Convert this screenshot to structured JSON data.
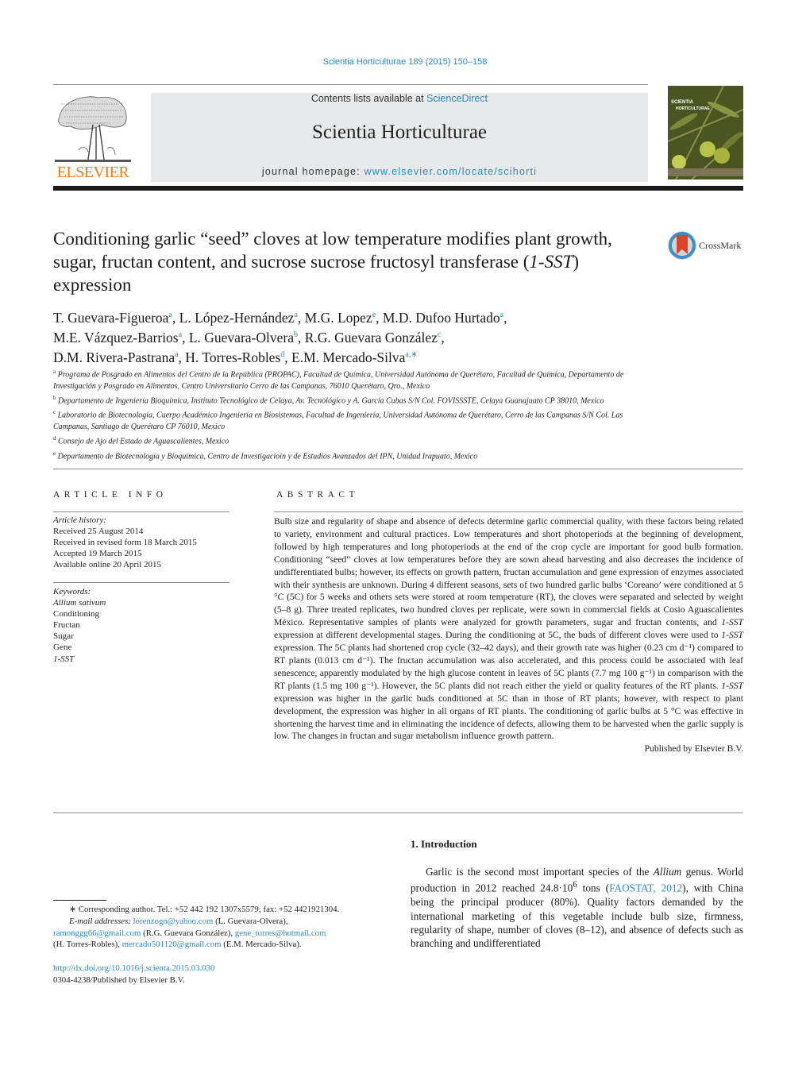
{
  "header": {
    "journal_ref": "Scientia Horticulturae 189 (2015) 150–158",
    "contents_prefix": "Contents lists available at ",
    "contents_link": "ScienceDirect",
    "journal_title": "Scientia Horticulturae",
    "homepage_prefix": "journal homepage: ",
    "homepage_link": "www.elsevier.com/locate/scihorti",
    "publisher_logo_text": "ELSEVIER",
    "cover_title_line1": "SCIENTIA",
    "cover_title_line2": "HORTICULTURAE"
  },
  "article": {
    "title_part1": "Conditioning garlic “seed” cloves at low temperature modifies plant growth, sugar, fructan content, and sucrose sucrose fructosyl transferase (",
    "title_italic": "1-SST",
    "title_part2": ") expression",
    "crossmark_label": "CrossMark",
    "authors": [
      {
        "name": "T. Guevara-Figueroa",
        "sup": "a",
        "sep": ", "
      },
      {
        "name": "L. López-Hernández",
        "sup": "a",
        "sep": ", "
      },
      {
        "name": "M.G. Lopez",
        "sup": "e",
        "sep": ", "
      },
      {
        "name": "M.D. Dufoo Hurtado",
        "sup": "a",
        "sep": ","
      },
      {
        "name": "M.E. Vázquez-Barrios",
        "sup": "a",
        "sep": ", "
      },
      {
        "name": "L. Guevara-Olvera",
        "sup": "b",
        "sep": ", "
      },
      {
        "name": "R.G. Guevara González",
        "sup": "c",
        "sep": ","
      },
      {
        "name": "D.M. Rivera-Pastrana",
        "sup": "a",
        "sep": ", "
      },
      {
        "name": "H. Torres-Robles",
        "sup": "d",
        "sep": ", "
      },
      {
        "name": "E.M. Mercado-Silva",
        "sup": "a,∗",
        "sep": ""
      }
    ],
    "affiliations": [
      {
        "key": "a",
        "text": "Programa de Posgrado en Alimentos del Centro de la República (PROPAC), Facultad de Química, Universidad Autónoma de Querétaro, Facultad de Química, Departamento de Investigación y Posgrado en Alimentos, Centro Universitario Cerro de las Campanas, 76010 Querétaro, Qro., Mexico"
      },
      {
        "key": "b",
        "text": "Departamento de Ingeniería Bioquímica, Instituto Tecnológico de Celaya, Av. Tecnológico y A. García Cubas S/N Col. FOVISSSTE, Celaya Guanajuato CP 38010, Mexico"
      },
      {
        "key": "c",
        "text": "Laboratorio de Biotecnología, Cuerpo Académico Ingeniería en Biosistemas, Facultad de Ingeniería, Universidad Autónoma de Querétaro, Cerro de las Campanas S/N Col. Las Campanas, Santiago de Querétaro CP 76010, Mexico"
      },
      {
        "key": "d",
        "text": "Consejo de Ajo del Estado de Aguascalientes, Mexico"
      },
      {
        "key": "e",
        "text": "Departamento de Biotecnología y Bioquímica, Centro de Investigacioín y de Estudios Avanzados del IPN, Unidad Irapuato, Mexico"
      }
    ]
  },
  "article_info": {
    "heading": "ARTICLE INFO",
    "history_label": "Article history:",
    "history": [
      "Received 25 August 2014",
      "Received in revised form 18 March 2015",
      "Accepted 19 March 2015",
      "Available online 20 April 2015"
    ],
    "keywords_label": "Keywords:",
    "keywords": [
      {
        "text": "Allium sativum",
        "italic": true
      },
      {
        "text": "Conditioning",
        "italic": false
      },
      {
        "text": "Fructan",
        "italic": false
      },
      {
        "text": "Sugar",
        "italic": false
      },
      {
        "text": "Gene",
        "italic": false
      },
      {
        "text": "1-SST",
        "italic": true
      }
    ]
  },
  "abstract": {
    "heading": "ABSTRACT",
    "segments": [
      {
        "t": "Bulb size and regularity of shape and absence of defects determine garlic commercial quality, with these factors being related to variety, environment and cultural practices. Low temperatures and short photoperiods at the beginning of development, followed by high temperatures and long photoperiods at the end of the crop cycle are important for good bulb formation. Conditioning “seed” cloves at low temperatures before they are sown ahead harvesting and also decreases the incidence of undifferentiated bulbs; however, its effects on growth pattern, fructan accumulation and gene expression of enzymes associated with their synthesis are unknown. During 4 different seasons, sets of two hundred garlic bulbs ‘Coreano’ were conditioned at 5 °C (5C) for 5 weeks and others sets were stored at room temperature (RT), the cloves were separated and selected by weight (5–8 g). Three treated replicates, two hundred cloves per replicate, were sown in commercial fields at Cosio Aguascalientes México. Representative samples of plants were analyzed for growth parameters, sugar and fructan contents, and ",
        "i": false
      },
      {
        "t": "1-SST",
        "i": true
      },
      {
        "t": " expression at different developmental stages. During the conditioning at 5C, the buds of different cloves were used to ",
        "i": false
      },
      {
        "t": "1-SST",
        "i": true
      },
      {
        "t": " expression. The 5C plants had shortened crop cycle (32–42 days), and their growth rate was higher (0.23 cm d⁻¹) compared to RT plants (0.013 cm d⁻¹). The fructan accumulation was also accelerated, and this process could be associated with leaf senescence, apparently modulated by the high glucose content in leaves of 5C plants (7.7 mg 100 g⁻¹) in comparison with the RT plants (1.5 mg 100 g⁻¹). However, the 5C plants did not reach either the yield or quality features of the RT plants. ",
        "i": false
      },
      {
        "t": "1-SST",
        "i": true
      },
      {
        "t": " expression was higher in the garlic buds conditioned at 5C than in those of RT plants; however, with respect to plant development, the expression was higher in all organs of RT plants. The conditioning of garlic bulbs at 5 °C was effective in shortening the harvest time and in eliminating the incidence of defects, allowing them to be harvested when the garlic supply is low. The changes in fructan and sugar metabolism influence growth pattern.",
        "i": false
      }
    ],
    "publisher_line": "Published by Elsevier B.V."
  },
  "introduction": {
    "heading": "1.  Introduction",
    "p1_a": "Garlic is the second most important species of the ",
    "p1_italic": "Allium",
    "p1_b": " genus. World production in 2012 reached 24.8·10",
    "p1_sup": "6",
    "p1_c": " tons (",
    "p1_link": "FAOSTAT, 2012",
    "p1_d": "), with China being the principal producer (80%). Quality factors demanded by the international marketing of this vegetable include bulb size, firmness, regularity of shape, number of cloves (8–12), and absence of defects such as branching and undifferentiated"
  },
  "footnotes": {
    "corresponding": "∗  Corresponding author. Tel.: +52 442 192 1307x5579; fax: +52 4421921304.",
    "email_label": "E-mail addresses: ",
    "emails": [
      {
        "email": "lorenzogo@yahoo.com",
        "name": " (L. Guevara-Olvera),"
      },
      {
        "email": "ramonggg66@gmail.com",
        "name": " (R.G. Guevara González), "
      },
      {
        "email": "gene_torres@hotmail.com",
        "name": " (H. Torres-Robles), "
      },
      {
        "email": "mercado501120@gmail.com",
        "name": " (E.M. Mercado-Silva)."
      }
    ],
    "doi": "http://dx.doi.org/10.1016/j.scienta.2015.03.030",
    "issn": "0304-4238/Published by Elsevier B.V."
  },
  "colors": {
    "link": "#2a8ab8",
    "elsevier_orange": "#f07c1a",
    "banner_bg": "#e8e9ea"
  }
}
